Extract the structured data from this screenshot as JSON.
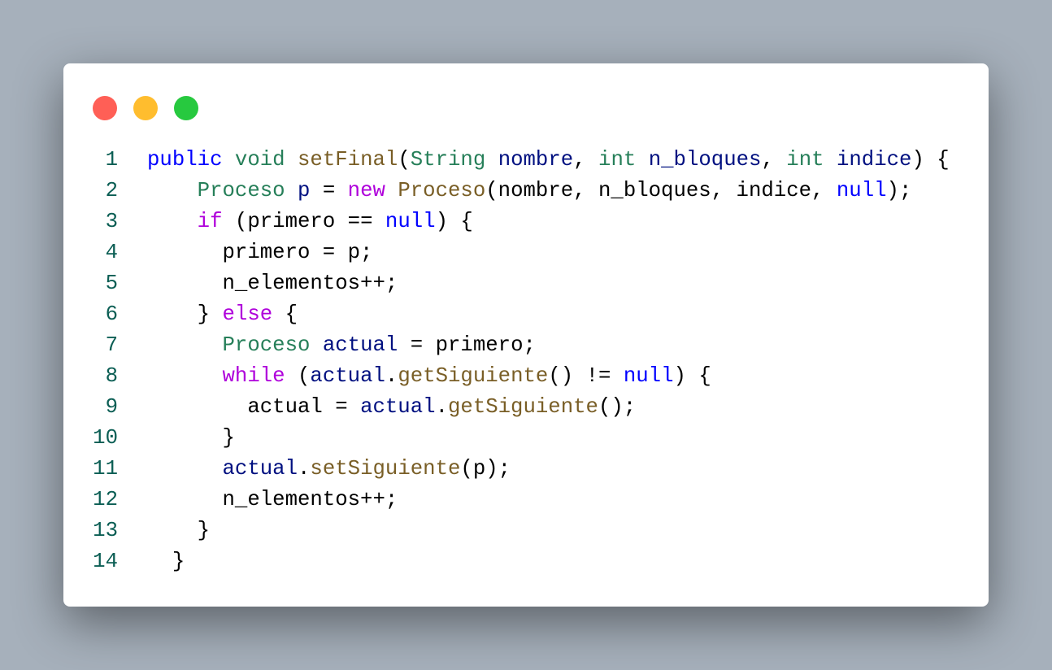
{
  "window": {
    "controls": [
      "close",
      "minimize",
      "maximize"
    ],
    "colors": {
      "close": "#ff5f56",
      "minimize": "#ffbd2e",
      "maximize": "#27c93f"
    }
  },
  "code": {
    "language": "java",
    "lines": [
      [
        [
          "kw",
          "public"
        ],
        [
          "",
          ""
        ],
        [
          "",
          ""
        ],
        [
          "type",
          " void"
        ],
        [
          "fn",
          " setFinal"
        ],
        [
          "",
          "("
        ],
        [
          "type",
          "String"
        ],
        [
          "var",
          " nombre"
        ],
        [
          "",
          ", "
        ],
        [
          "type",
          "int"
        ],
        [
          "var",
          " n_bloques"
        ],
        [
          "",
          ", "
        ],
        [
          "type",
          "int"
        ],
        [
          "var",
          " indice"
        ],
        [
          "",
          ") {"
        ]
      ],
      [
        [
          "",
          "    "
        ],
        [
          "type",
          "Proceso"
        ],
        [
          "var",
          " p"
        ],
        [
          "",
          " = "
        ],
        [
          "ctrl",
          "new"
        ],
        [
          "fn",
          " Proceso"
        ],
        [
          "",
          "(nombre, n_bloques, indice, "
        ],
        [
          "kw",
          "null"
        ],
        [
          "",
          ");"
        ]
      ],
      [
        [
          "",
          "    "
        ],
        [
          "ctrl",
          "if"
        ],
        [
          "",
          " (primero == "
        ],
        [
          "kw",
          "null"
        ],
        [
          "",
          ") {"
        ]
      ],
      [
        [
          "",
          "      primero = p;"
        ]
      ],
      [
        [
          "",
          "      n_elementos++;"
        ]
      ],
      [
        [
          "",
          "    } "
        ],
        [
          "ctrl",
          "else"
        ],
        [
          "",
          " {"
        ]
      ],
      [
        [
          "",
          "      "
        ],
        [
          "type",
          "Proceso"
        ],
        [
          "var",
          " actual"
        ],
        [
          "",
          " = primero;"
        ]
      ],
      [
        [
          "",
          "      "
        ],
        [
          "ctrl",
          "while"
        ],
        [
          "",
          " ("
        ],
        [
          "var",
          "actual"
        ],
        [
          "",
          "."
        ],
        [
          "fn",
          "getSiguiente"
        ],
        [
          "",
          "() != "
        ],
        [
          "kw",
          "null"
        ],
        [
          "",
          ") {"
        ]
      ],
      [
        [
          "",
          "        actual = "
        ],
        [
          "var",
          "actual"
        ],
        [
          "",
          "."
        ],
        [
          "fn",
          "getSiguiente"
        ],
        [
          "",
          "();"
        ]
      ],
      [
        [
          "",
          "      }"
        ]
      ],
      [
        [
          "",
          "      "
        ],
        [
          "var",
          "actual"
        ],
        [
          "",
          "."
        ],
        [
          "fn",
          "setSiguiente"
        ],
        [
          "",
          "(p);"
        ]
      ],
      [
        [
          "",
          "      n_elementos++;"
        ]
      ],
      [
        [
          "",
          "    }"
        ]
      ],
      [
        [
          "",
          "  }"
        ]
      ]
    ]
  }
}
